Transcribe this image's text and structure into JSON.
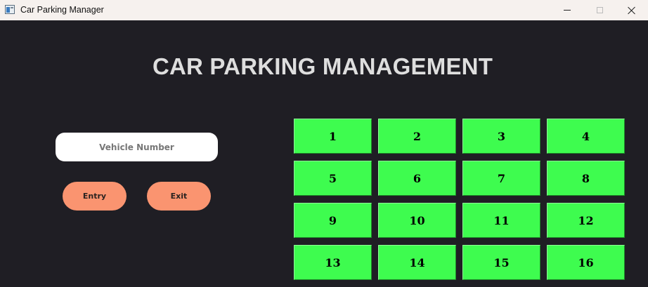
{
  "window": {
    "title": "Car Parking Manager"
  },
  "main": {
    "heading": "CAR PARKING MANAGEMENT",
    "vehicle_input": {
      "value": "",
      "placeholder": "Vehicle Number"
    },
    "entry_label": "Entry",
    "exit_label": "Exit"
  },
  "slots": [
    "1",
    "2",
    "3",
    "4",
    "5",
    "6",
    "7",
    "8",
    "9",
    "10",
    "11",
    "12",
    "13",
    "14",
    "15",
    "16"
  ],
  "colors": {
    "background": "#1f1e24",
    "titlebar": "#f6f1ee",
    "heading": "#dedede",
    "action_button": "#fa9470",
    "slot_free": "#3efc4f"
  }
}
